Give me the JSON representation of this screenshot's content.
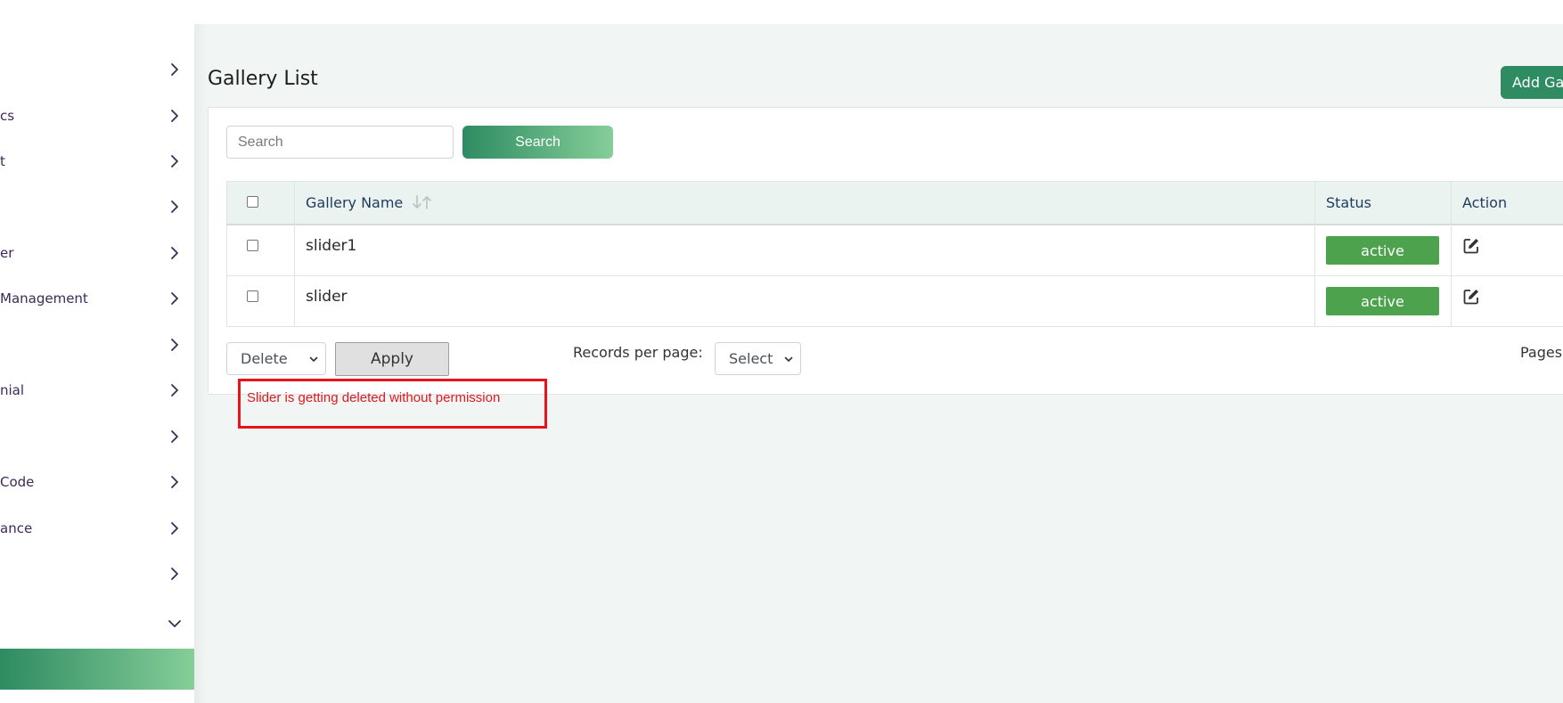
{
  "sidebar": {
    "items": [
      {
        "label": ""
      },
      {
        "label": "cs"
      },
      {
        "label": "t"
      },
      {
        "label": ""
      },
      {
        "label": "er"
      },
      {
        "label": " Management"
      },
      {
        "label": ""
      },
      {
        "label": "nial"
      },
      {
        "label": ""
      },
      {
        "label": " Code"
      },
      {
        "label": "ance"
      },
      {
        "label": ""
      },
      {
        "label": ""
      }
    ]
  },
  "page": {
    "title": "Gallery List",
    "add_button_label": "Add Ga"
  },
  "search": {
    "placeholder": "Search",
    "value": "",
    "button_label": "Search"
  },
  "table": {
    "headers": {
      "gallery_name": "Gallery Name",
      "status": "Status",
      "action": "Action"
    },
    "rows": [
      {
        "name": "slider1",
        "status": "active"
      },
      {
        "name": "slider",
        "status": "active"
      }
    ]
  },
  "bulk": {
    "selected_action": "Delete",
    "apply_label": "Apply"
  },
  "pagination": {
    "records_label": "Records per page:",
    "records_selected": "Select",
    "pages_label": "Pages"
  },
  "annotation": {
    "text": "Slider is getting deleted without permission",
    "color": "#e8141a"
  },
  "colors": {
    "accent": "#2e8b62",
    "accent_light": "#85ce98",
    "status_active": "#4da24d"
  }
}
